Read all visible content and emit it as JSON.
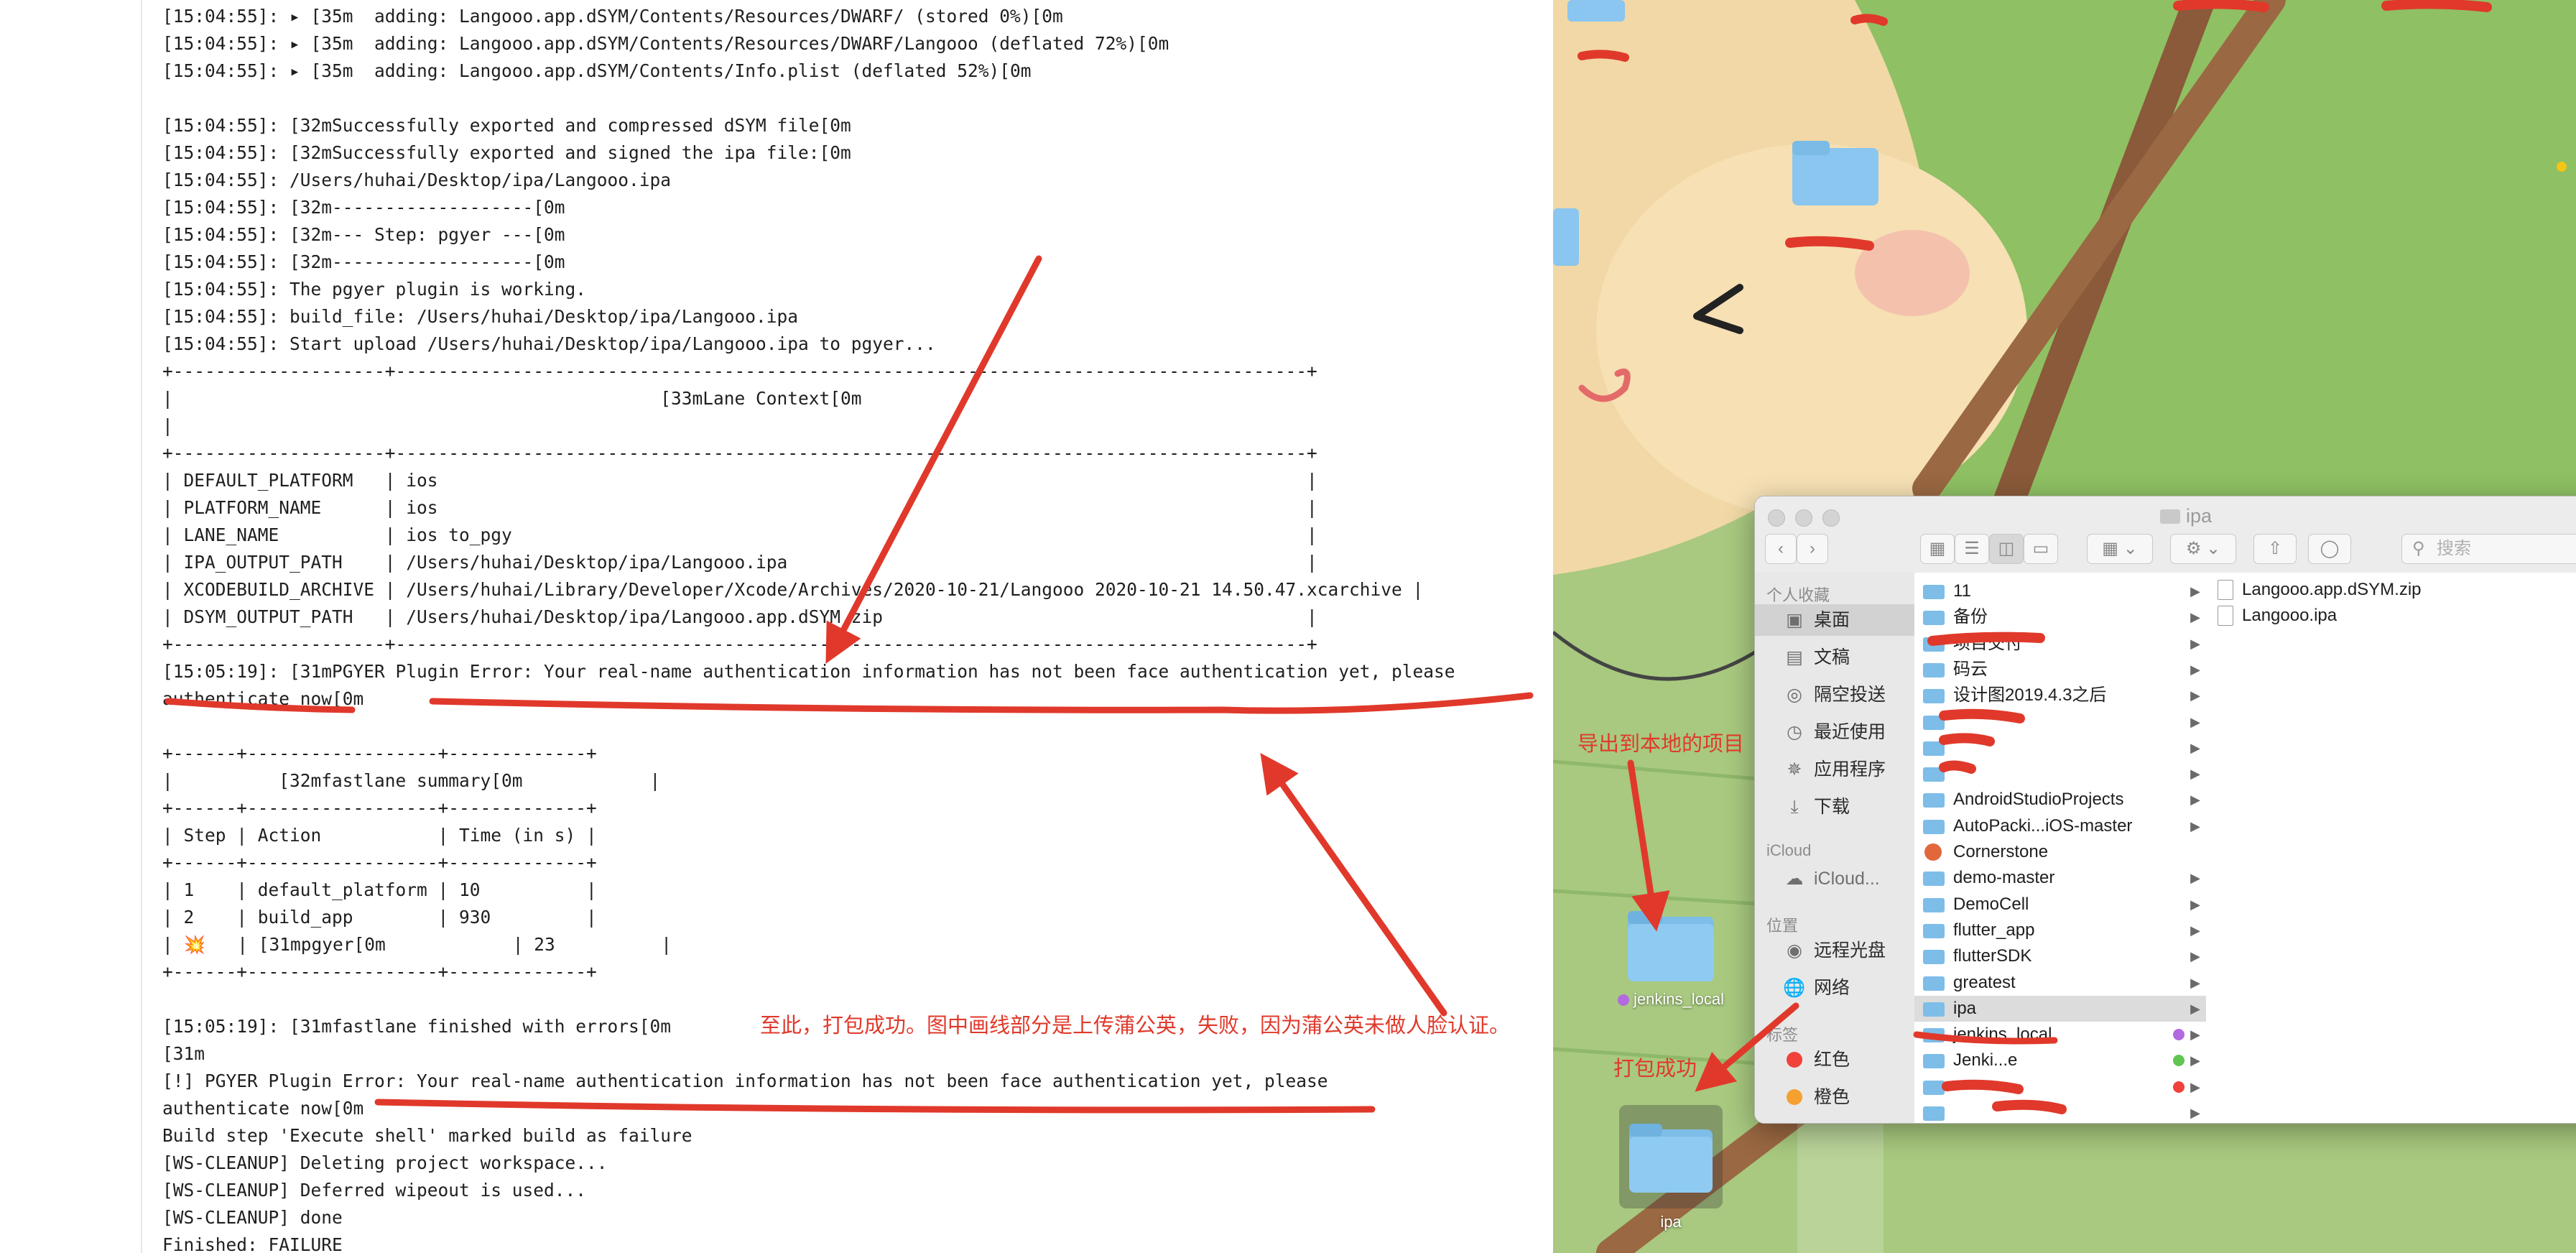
{
  "console": {
    "lines": [
      "[15:04:55]: ▸ [35m  adding: Langooo.app.dSYM/Contents/Resources/DWARF/ (stored 0%)[0m",
      "[15:04:55]: ▸ [35m  adding: Langooo.app.dSYM/Contents/Resources/DWARF/Langooo (deflated 72%)[0m",
      "[15:04:55]: ▸ [35m  adding: Langooo.app.dSYM/Contents/Info.plist (deflated 52%)[0m",
      "",
      "[15:04:55]: [32mSuccessfully exported and compressed dSYM file[0m",
      "[15:04:55]: [32mSuccessfully exported and signed the ipa file:[0m",
      "[15:04:55]: /Users/huhai/Desktop/ipa/Langooo.ipa",
      "[15:04:55]: [32m-------------------[0m",
      "[15:04:55]: [32m--- Step: pgyer ---[0m",
      "[15:04:55]: [32m-------------------[0m",
      "[15:04:55]: The pgyer plugin is working.",
      "[15:04:55]: build_file: /Users/huhai/Desktop/ipa/Langooo.ipa",
      "[15:04:55]: Start upload /Users/huhai/Desktop/ipa/Langooo.ipa to pgyer...",
      "+--------------------+--------------------------------------------------------------------------------------+",
      "|                                              [33mLane Context[0m",
      "|",
      "+--------------------+--------------------------------------------------------------------------------------+",
      "| DEFAULT_PLATFORM   | ios                                                                                  |",
      "| PLATFORM_NAME      | ios                                                                                  |",
      "| LANE_NAME          | ios to_pgy                                                                           |",
      "| IPA_OUTPUT_PATH    | /Users/huhai/Desktop/ipa/Langooo.ipa                                                 |",
      "| XCODEBUILD_ARCHIVE | /Users/huhai/Library/Developer/Xcode/Archives/2020-10-21/Langooo 2020-10-21 14.50.47.xcarchive |",
      "| DSYM_OUTPUT_PATH   | /Users/huhai/Desktop/ipa/Langooo.app.dSYM.zip                                        |",
      "+--------------------+--------------------------------------------------------------------------------------+",
      "[15:05:19]: [31mPGYER Plugin Error: Your real-name authentication information has not been face authentication yet, please",
      "authenticate now[0m",
      "",
      "+------+------------------+-------------+",
      "|          [32mfastlane summary[0m            |",
      "+------+------------------+-------------+",
      "| Step | Action           | Time (in s) |",
      "+------+------------------+-------------+",
      "| 1    | default_platform | 10          |",
      "| 2    | build_app        | 930         |",
      "| 💥   | [31mpgyer[0m            | 23          |",
      "+------+------------------+-------------+",
      "",
      "[15:05:19]: [31mfastlane finished with errors[0m",
      "[31m",
      "[!] PGYER Plugin Error: Your real-name authentication information has not been face authentication yet, please",
      "authenticate now[0m",
      "Build step 'Execute shell' marked build as failure",
      "[WS-CLEANUP] Deleting project workspace...",
      "[WS-CLEANUP] Deferred wipeout is used...",
      "[WS-CLEANUP] done",
      "Finished: FAILURE"
    ]
  },
  "annotations": {
    "success_note": "至此，打包成功。图中画线部分是上传蒲公英，失败，因为蒲公英未做人脸认证。",
    "export_note": "导出到本地的项目",
    "packaged_note": "打包成功",
    "color": "#e0392b"
  },
  "desktop": {
    "folders": [
      {
        "label": "jenkins_local",
        "tag_color": "#b36ae0"
      },
      {
        "label": "ipa"
      }
    ]
  },
  "finder": {
    "title": "ipa",
    "search_placeholder": "搜索",
    "sidebar": {
      "favorites_header": "个人收藏",
      "favorites": [
        {
          "label": "桌面",
          "icon": "desktop-icon",
          "selected": true
        },
        {
          "label": "文稿",
          "icon": "documents-icon"
        },
        {
          "label": "隔空投送",
          "icon": "airdrop-icon"
        },
        {
          "label": "最近使用",
          "icon": "clock-icon"
        },
        {
          "label": "应用程序",
          "icon": "applications-icon"
        },
        {
          "label": "下载",
          "icon": "download-icon"
        }
      ],
      "icloud_header": "iCloud",
      "icloud": [
        {
          "label": "iCloud...",
          "icon": "cloud-icon"
        }
      ],
      "locations_header": "位置",
      "locations": [
        {
          "label": "远程光盘",
          "icon": "disc-icon"
        },
        {
          "label": "网络",
          "icon": "network-icon"
        }
      ],
      "tags_header": "标签",
      "tags": [
        {
          "label": "红色",
          "color": "#f0413b"
        },
        {
          "label": "橙色",
          "color": "#f6a032"
        }
      ]
    },
    "column1": [
      {
        "name": "11",
        "arrow": true
      },
      {
        "name": "备份",
        "arrow": true
      },
      {
        "name": "项目交付",
        "arrow": true,
        "redacted": true
      },
      {
        "name": "码云",
        "arrow": true
      },
      {
        "name": "设计图2019.4.3之后",
        "arrow": true
      },
      {
        "name": "",
        "arrow": true,
        "redacted": true
      },
      {
        "name": "",
        "arrow": true,
        "redacted": true
      },
      {
        "name": "",
        "arrow": true,
        "redacted": true
      },
      {
        "name": "AndroidStudioProjects",
        "arrow": true
      },
      {
        "name": "AutoPacki...iOS-master",
        "arrow": true
      },
      {
        "name": "Cornerstone",
        "arrow": false,
        "app": true
      },
      {
        "name": "demo-master",
        "arrow": true
      },
      {
        "name": "DemoCell",
        "arrow": true
      },
      {
        "name": "flutter_app",
        "arrow": true
      },
      {
        "name": "flutterSDK",
        "arrow": true
      },
      {
        "name": "greatest",
        "arrow": true
      },
      {
        "name": "ipa",
        "arrow": true,
        "selected": true
      },
      {
        "name": "jenkins_local",
        "arrow": true,
        "tag": "#b36ae0"
      },
      {
        "name": "Jenki...e",
        "arrow": true,
        "tag": "#61c554",
        "redacted": true
      },
      {
        "name": "",
        "arrow": true,
        "tag": "#f0413b",
        "redacted": true
      },
      {
        "name": "",
        "arrow": true,
        "redacted": true
      }
    ],
    "column2": [
      {
        "name": "Langooo.app.dSYM.zip"
      },
      {
        "name": "Langooo.ipa"
      }
    ]
  }
}
